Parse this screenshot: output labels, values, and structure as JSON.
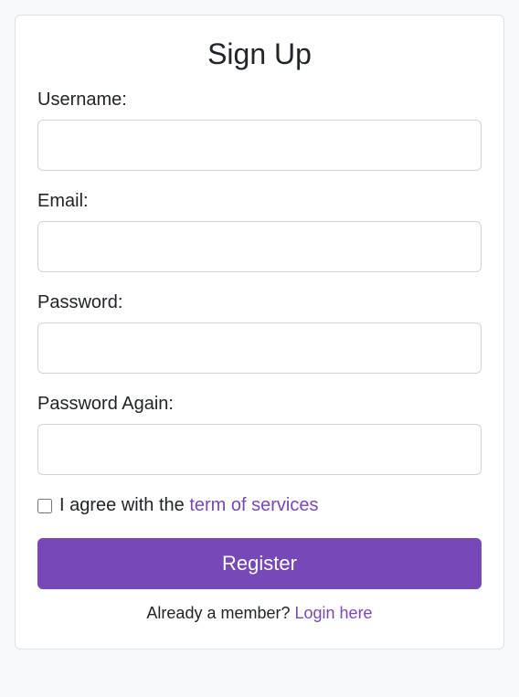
{
  "title": "Sign Up",
  "fields": {
    "username": {
      "label": "Username:",
      "value": ""
    },
    "email": {
      "label": "Email:",
      "value": ""
    },
    "password": {
      "label": "Password:",
      "value": ""
    },
    "password_again": {
      "label": "Password Again:",
      "value": ""
    }
  },
  "agree": {
    "checked": false,
    "prefix": "I agree with the ",
    "link_text": "term of services"
  },
  "register_button": "Register",
  "footer": {
    "prefix": "Already a member? ",
    "link_text": "Login here"
  },
  "colors": {
    "accent": "#7749b8",
    "link": "#7749b8"
  }
}
